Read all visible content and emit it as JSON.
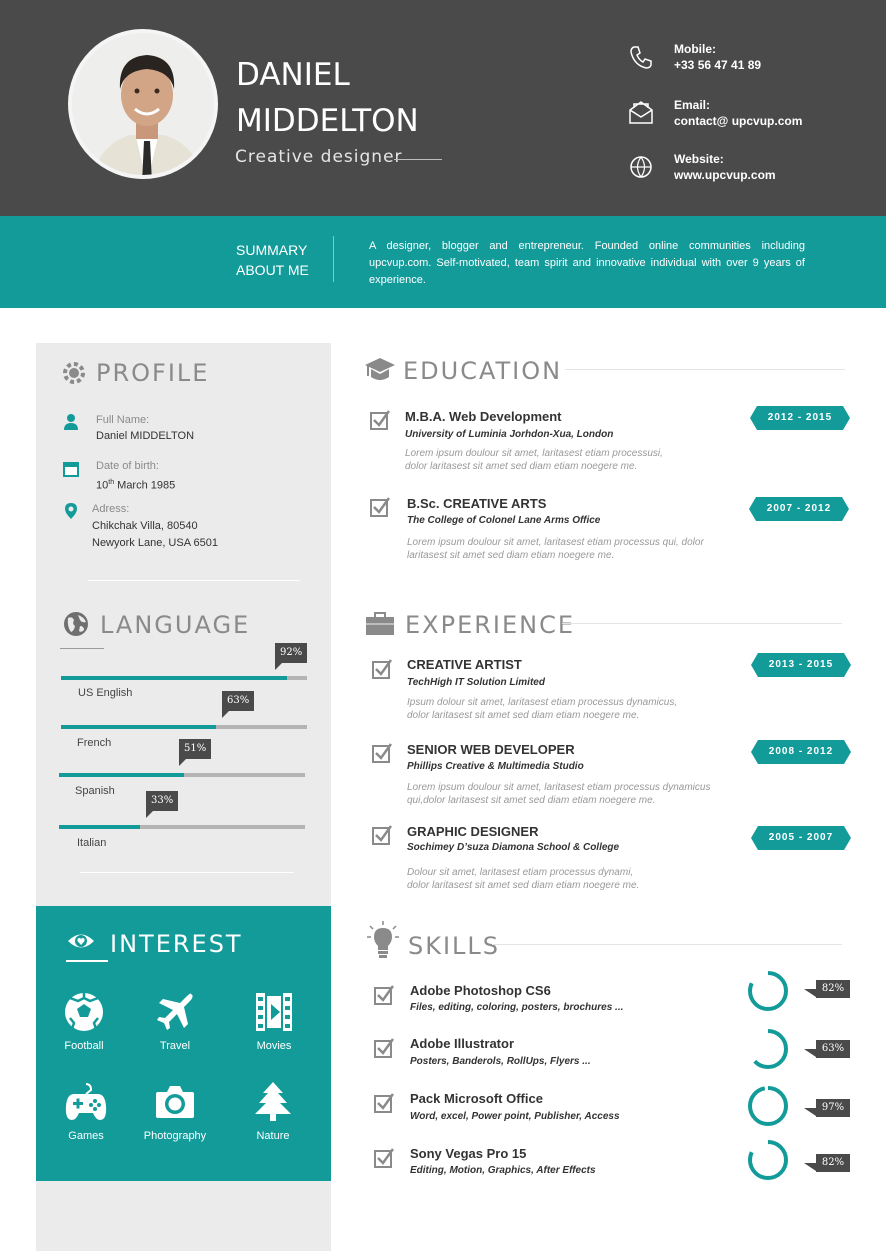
{
  "header": {
    "name_line1": "DANIEL",
    "name_line2": "MIDDELTON",
    "role": "Creative designer",
    "contacts": [
      {
        "label": "Mobile:",
        "value": "+33 56 47 41 89",
        "icon": "phone-icon"
      },
      {
        "label": "Email:",
        "value": "contact@ upcvup.com",
        "icon": "envelope-icon"
      },
      {
        "label": "Website:",
        "value": "www.upcvup.com",
        "icon": "globe-icon"
      }
    ]
  },
  "summary": {
    "title_line1": "SUMMARY",
    "title_line2": "ABOUT ME",
    "text": "A designer, blogger and entrepreneur. Founded online communities including upcvup.com. Self-motivated, team spirit and innovative individual with over 9 years of experience."
  },
  "profile": {
    "heading": "PROFILE",
    "full_name_label": "Full Name:",
    "full_name": "Daniel MIDDELTON",
    "dob_label": "Date of birth:",
    "dob_day": "10",
    "dob_suffix": "th",
    "dob_rest": " March 1985",
    "address_label": "Adress:",
    "address_line1": "Chikchak Villa, 80540",
    "address_line2": "Newyork Lane, USA 6501"
  },
  "language": {
    "heading": "LANGUAGE",
    "items": [
      {
        "name": "US English",
        "percent": 92,
        "label": "92%"
      },
      {
        "name": "French",
        "percent": 63,
        "label": "63%"
      },
      {
        "name": "Spanish",
        "percent": 51,
        "label": "51%"
      },
      {
        "name": "Italian",
        "percent": 33,
        "label": "33%"
      }
    ]
  },
  "interest": {
    "heading": "INTEREST",
    "items": [
      {
        "label": "Football",
        "icon": "football-icon"
      },
      {
        "label": "Travel",
        "icon": "airplane-icon"
      },
      {
        "label": "Movies",
        "icon": "film-icon"
      },
      {
        "label": "Games",
        "icon": "gamepad-icon"
      },
      {
        "label": "Photography",
        "icon": "camera-icon"
      },
      {
        "label": "Nature",
        "icon": "tree-icon"
      }
    ]
  },
  "education": {
    "heading": "EDUCATION",
    "items": [
      {
        "title": "M.B.A. Web Development",
        "org": "University of Luminia Jorhdon-Xua, London",
        "desc_line1": "Lorem ipsum doulour sit amet, laritasest etiam processusi,",
        "desc_line2": "dolor laritasest  sit amet sed diam etiam noegere me.",
        "dates": "2012 - 2015"
      },
      {
        "title": "B.Sc. CREATIVE ARTS",
        "org": "The College of Colonel Lane Arms Office",
        "desc_line1": "Lorem ipsum doulour sit amet, laritasest etiam processus qui, dolor",
        "desc_line2": "laritasest  sit amet sed diam etiam noegere me.",
        "dates": "2007 - 2012"
      }
    ]
  },
  "experience": {
    "heading": "EXPERIENCE",
    "items": [
      {
        "title": "CREATIVE ARTIST",
        "org": "TechHigh IT Solution Limited",
        "desc_line1": "Ipsum dolour sit amet, laritasest etiam processus dynamicus,",
        "desc_line2": "dolor laritasest  sit amet sed diam etiam noegere me.",
        "dates": "2013 - 2015"
      },
      {
        "title": "SENIOR WEB DEVELOPER",
        "org": "Phillips Creative & Multimedia Studio",
        "desc_line1": "Lorem ipsum doulour sit amet, laritasest etiam processus dynamicus",
        "desc_line2": "qui,dolor laritasest  sit amet sed diam etiam noegere me.",
        "dates": "2008 - 2012"
      },
      {
        "title": "GRAPHIC DESIGNER",
        "org": "Sochimey D’suza Diamona School & College",
        "desc_line1": "Dolour sit amet, laritasest etiam processus dynami,",
        "desc_line2": "dolor laritasest  sit amet sed diam etiam noegere me.",
        "dates": "2005 - 2007"
      }
    ]
  },
  "skills": {
    "heading": "SKILLS",
    "items": [
      {
        "title": "Adobe Photoshop CS6",
        "desc": "Files, editing, coloring, posters, brochures ...",
        "percent": 82,
        "label": "82%"
      },
      {
        "title": "Adobe Illustrator",
        "desc": "Posters, Banderols, RollUps, Flyers ...",
        "percent": 63,
        "label": "63%"
      },
      {
        "title": "Pack Microsoft Office",
        "desc": "Word, excel, Power point, Publisher, Access",
        "percent": 97,
        "label": "97%"
      },
      {
        "title": "Sony Vegas Pro 15",
        "desc": "Editing, Motion, Graphics, After Effects",
        "percent": 82,
        "label": "82%"
      }
    ]
  },
  "colors": {
    "accent": "#139b9a",
    "dark": "#4a4a4b",
    "sidebar": "#ebebeb"
  }
}
